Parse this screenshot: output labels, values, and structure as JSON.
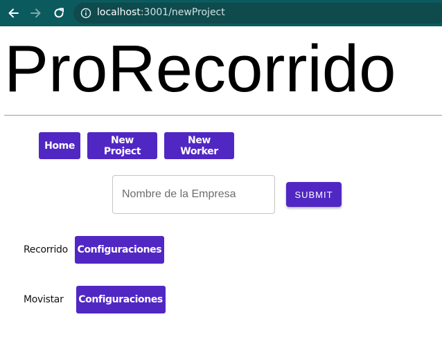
{
  "browser": {
    "url_host": "localhost",
    "url_path": ":3001/newProject",
    "icons": [
      "back-arrow-icon",
      "forward-arrow-icon",
      "reload-icon",
      "info-icon"
    ],
    "bar_color": "#0b5a5e"
  },
  "page": {
    "title": "ProRecorrido",
    "nav": {
      "home": "Home",
      "new_project": "New Project",
      "new_worker": "New Worker"
    },
    "form": {
      "company_placeholder": "Nombre de la Empresa",
      "submit_label": "SUBMIT"
    },
    "projects": [
      {
        "name": "Recorrido",
        "button_label": "Configuraciones"
      },
      {
        "name": "Movistar",
        "button_label": "Configuraciones"
      }
    ],
    "accent_color": "#5127c4"
  }
}
